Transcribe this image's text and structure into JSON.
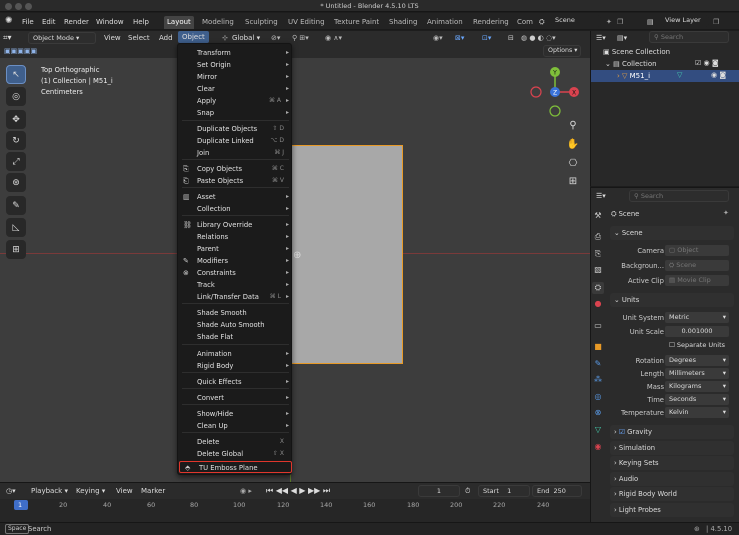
{
  "window": {
    "title": "* Untitled - Blender 4.5.10 LTS"
  },
  "topmenu": [
    "File",
    "Edit",
    "Render",
    "Window",
    "Help"
  ],
  "workspaces": [
    "Layout",
    "Modeling",
    "Sculpting",
    "UV Editing",
    "Texture Paint",
    "Shading",
    "Animation",
    "Rendering",
    "Com"
  ],
  "scene_field": "Scene",
  "view_layer_field": "View Layer",
  "viewport_header": {
    "mode": "Object Mode",
    "menus": [
      "View",
      "Select",
      "Add",
      "Object"
    ],
    "transform": "Global",
    "options": "Options"
  },
  "overlay": {
    "line1": "Top Orthographic",
    "line2": "(1) Collection | M51_i",
    "line3": "Centimeters"
  },
  "object_menu": [
    {
      "label": "Transform",
      "arrow": true
    },
    {
      "label": "Set Origin",
      "arrow": true
    },
    {
      "label": "Mirror",
      "arrow": true
    },
    {
      "label": "Clear",
      "arrow": true
    },
    {
      "label": "Apply",
      "shortcut": "⌘ A",
      "arrow": true
    },
    {
      "label": "Snap",
      "arrow": true
    },
    {
      "label": "Duplicate Objects",
      "shortcut": "⇧ D"
    },
    {
      "label": "Duplicate Linked",
      "shortcut": "⌥ D"
    },
    {
      "label": "Join",
      "shortcut": "⌘ J"
    },
    {
      "label": "Copy Objects",
      "shortcut": "⌘ C"
    },
    {
      "label": "Paste Objects",
      "shortcut": "⌘ V"
    },
    {
      "label": "Asset",
      "arrow": true
    },
    {
      "label": "Collection",
      "arrow": true
    },
    {
      "label": "Library Override",
      "arrow": true
    },
    {
      "label": "Relations",
      "arrow": true
    },
    {
      "label": "Parent",
      "arrow": true
    },
    {
      "label": "Modifiers",
      "arrow": true
    },
    {
      "label": "Constraints",
      "arrow": true
    },
    {
      "label": "Track",
      "arrow": true
    },
    {
      "label": "Link/Transfer Data",
      "shortcut": "⌘ L",
      "arrow": true
    },
    {
      "label": "Shade Smooth"
    },
    {
      "label": "Shade Auto Smooth"
    },
    {
      "label": "Shade Flat"
    },
    {
      "label": "Animation",
      "arrow": true
    },
    {
      "label": "Rigid Body",
      "arrow": true
    },
    {
      "label": "Quick Effects",
      "arrow": true
    },
    {
      "label": "Convert",
      "arrow": true
    },
    {
      "label": "Show/Hide",
      "arrow": true
    },
    {
      "label": "Clean Up",
      "arrow": true
    },
    {
      "label": "Delete",
      "shortcut": "X"
    },
    {
      "label": "Delete Global",
      "shortcut": "⇧ X"
    },
    {
      "label": "TU Emboss Plane",
      "highlight": true
    }
  ],
  "timeline": {
    "menus": [
      "Playback",
      "Keying",
      "View",
      "Marker"
    ],
    "current_frame": "1",
    "start_label": "Start",
    "start": "1",
    "end_label": "End",
    "end": "250",
    "ticks": [
      "1",
      "20",
      "40",
      "60",
      "80",
      "100",
      "120",
      "140",
      "160",
      "180",
      "200",
      "220",
      "240"
    ]
  },
  "status": {
    "key": "Space",
    "action": "Search",
    "version": "4.5.10"
  },
  "outliner": {
    "search_placeholder": "Search",
    "items": [
      "Scene Collection",
      "Collection",
      "M51_i"
    ]
  },
  "properties": {
    "search_placeholder": "Search",
    "context": "Scene",
    "scene_panel": "Scene",
    "camera_label": "Camera",
    "camera_value": "Object",
    "background_label": "Backgroun...",
    "background_value": "Scene",
    "clip_label": "Active Clip",
    "clip_value": "Movie Clip",
    "units_panel": "Units",
    "unit_system_label": "Unit System",
    "unit_system": "Metric",
    "unit_scale_label": "Unit Scale",
    "unit_scale": "0.001000",
    "separate_units": "Separate Units",
    "rotation_label": "Rotation",
    "rotation": "Degrees",
    "length_label": "Length",
    "length": "Millimeters",
    "mass_label": "Mass",
    "mass": "Kilograms",
    "time_label": "Time",
    "time": "Seconds",
    "temperature_label": "Temperature",
    "temperature": "Kelvin",
    "collapsed_panels": [
      "Gravity",
      "Simulation",
      "Keying Sets",
      "Audio",
      "Rigid Body World",
      "Light Probes"
    ]
  },
  "colors": {
    "accent": "#e89a27",
    "highlight_border": "#e0362c",
    "active_blue": "#3f5f8c"
  }
}
